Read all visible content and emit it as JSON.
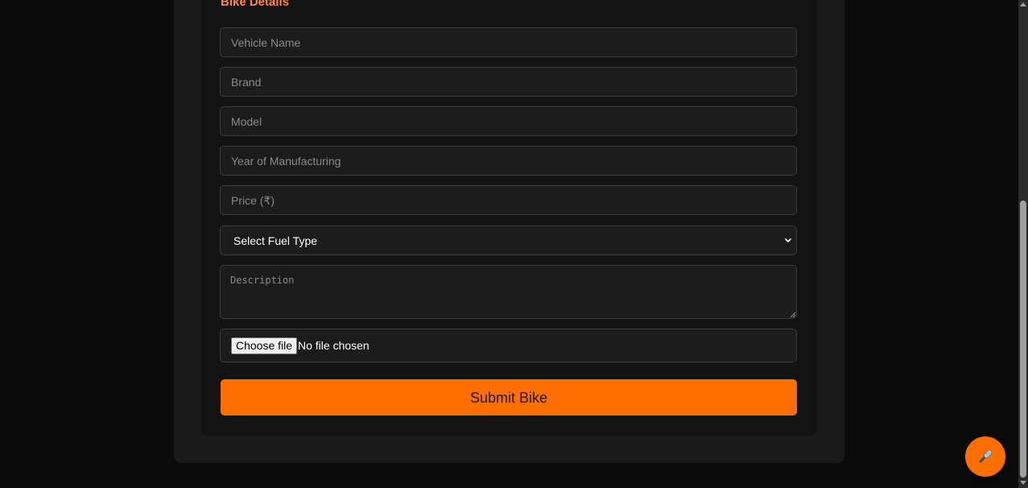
{
  "form": {
    "section_title": "Bike Details",
    "fields": {
      "vehicle_name": {
        "placeholder": "Vehicle Name",
        "value": ""
      },
      "brand": {
        "placeholder": "Brand",
        "value": ""
      },
      "model": {
        "placeholder": "Model",
        "value": ""
      },
      "year": {
        "placeholder": "Year of Manufacturing",
        "value": ""
      },
      "price": {
        "placeholder": "Price (₹)",
        "value": ""
      },
      "fuel_type": {
        "selected": "Select Fuel Type"
      },
      "description": {
        "placeholder": "Description",
        "value": ""
      },
      "image": {
        "button_label": "Choose file",
        "status": "No file chosen"
      }
    },
    "submit_label": "Submit Bike"
  },
  "colors": {
    "accent": "#ff6f00",
    "title_accent": "#ff8a3d",
    "page_background": "#0b0b0b",
    "card_background": "#131313",
    "field_background": "#1c1c1c"
  },
  "floating_button": {
    "icon": "mic-icon"
  },
  "icons": [
    "chevron-down-icon",
    "resize-handle-icon",
    "mic-icon",
    "scroll-up-icon",
    "scroll-down-icon"
  ]
}
